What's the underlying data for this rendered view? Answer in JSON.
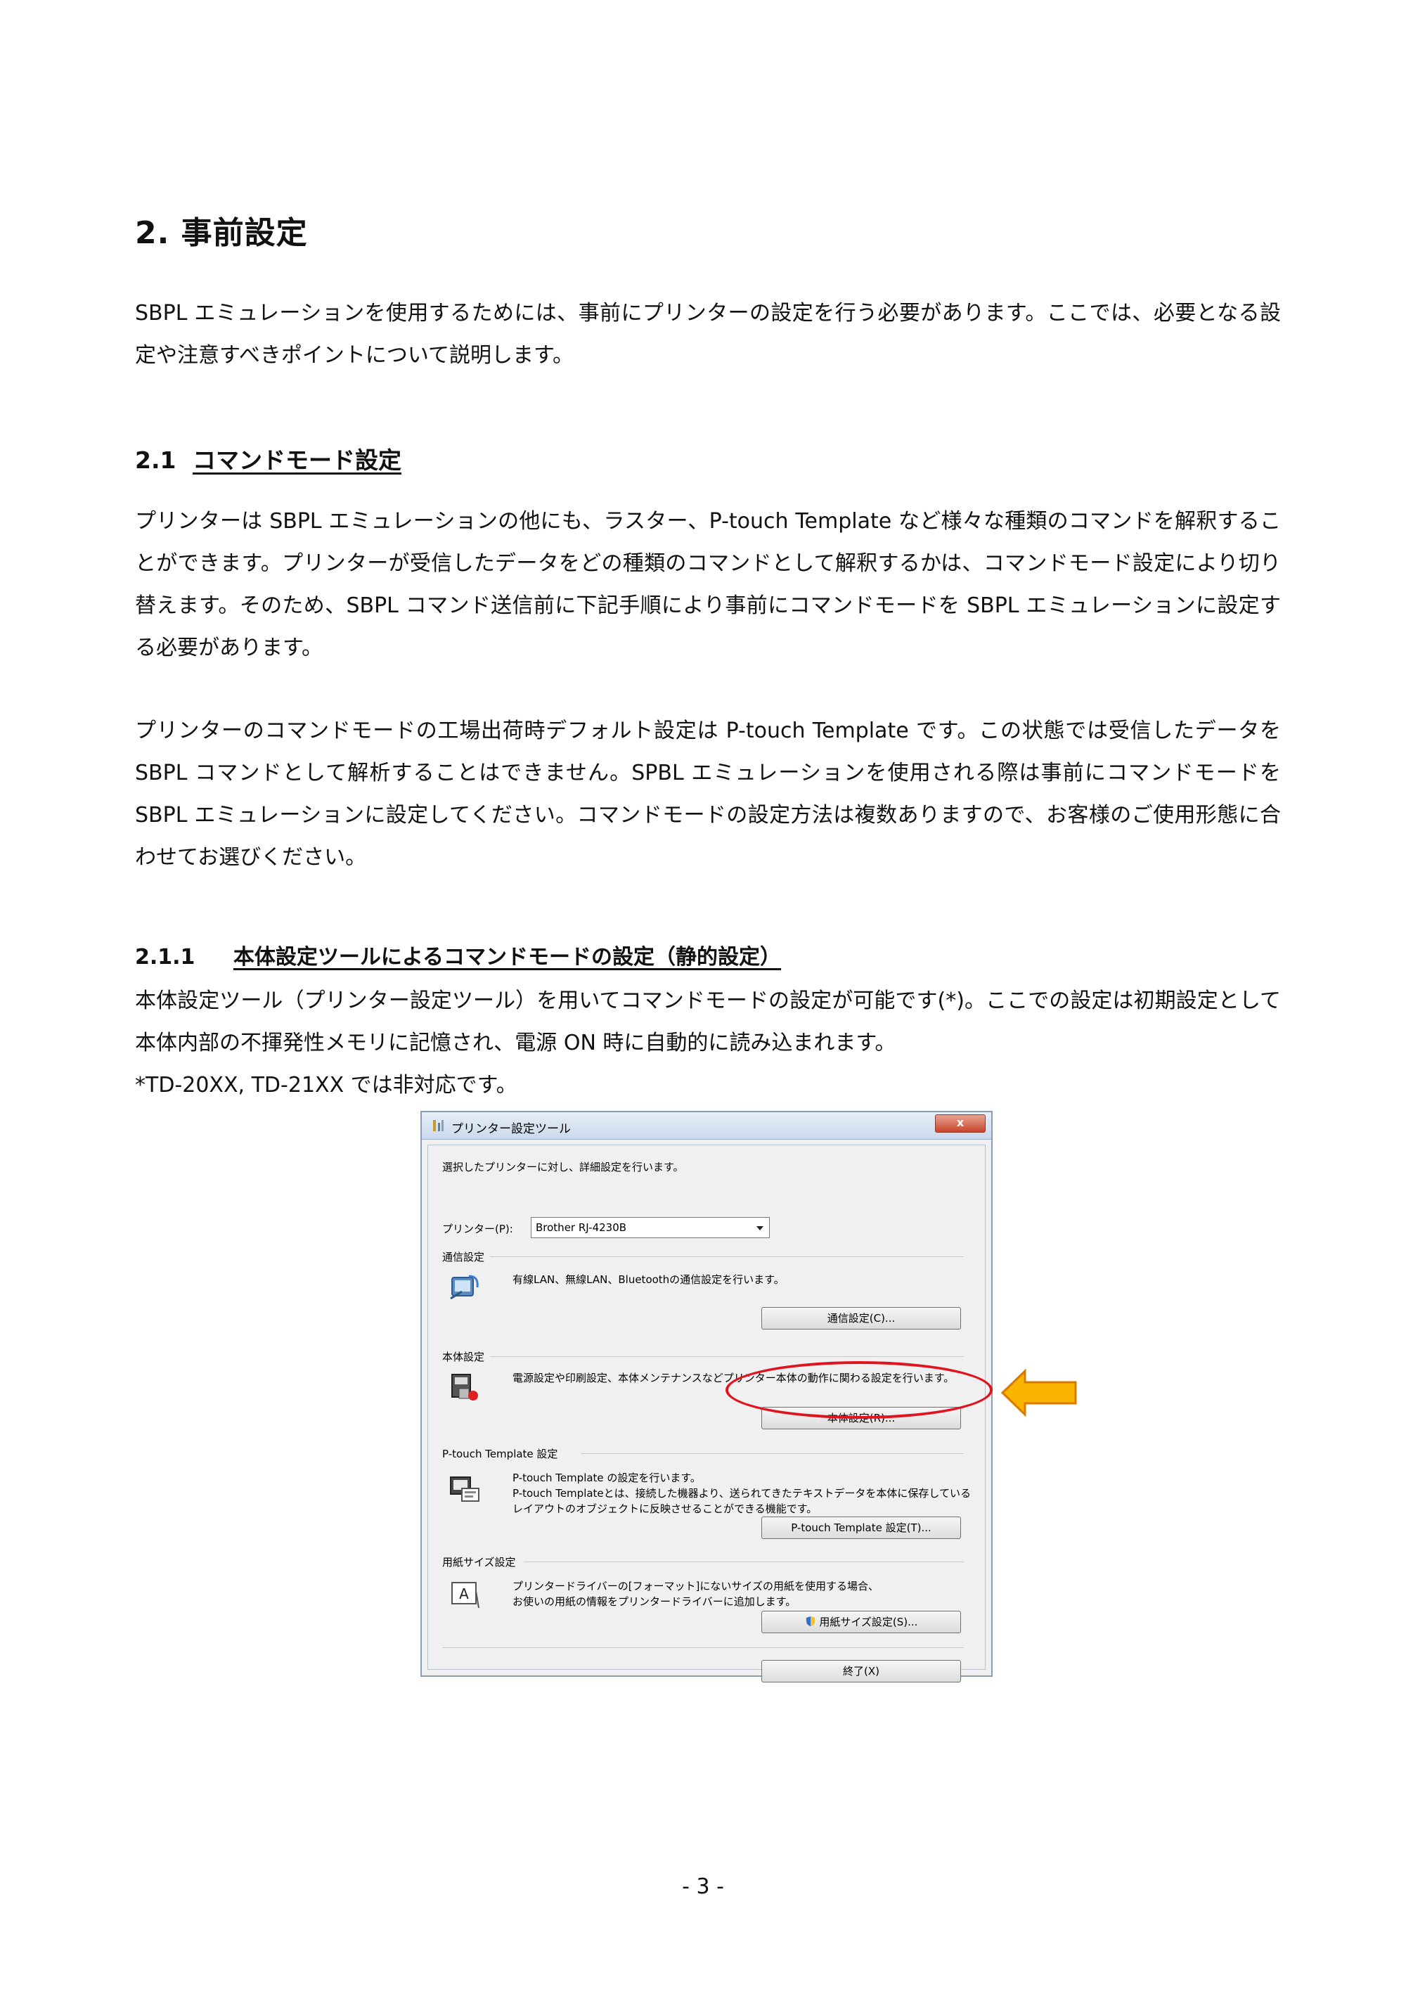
{
  "section": {
    "title": "2.  事前設定",
    "intro": "SBPL エミュレーションを使用するためには、事前にプリンターの設定を行う必要があります。ここでは、必要となる設定や注意すべきポイントについて説明します。"
  },
  "subsection": {
    "number": "2.1",
    "title": "コマンドモード設定",
    "para1": "プリンターは SBPL エミュレーションの他にも、ラスター、P-touch Template など様々な種類のコマンドを解釈することができます。プリンターが受信したデータをどの種類のコマンドとして解釈するかは、コマンドモード設定により切り替えます。そのため、SBPL コマンド送信前に下記手順により事前にコマンドモードを SBPL エミュレーションに設定する必要があります。",
    "para2": "プリンターのコマンドモードの工場出荷時デフォルト設定は P-touch Template です。この状態では受信したデータを SBPL コマンドとして解析することはできません。SPBL エミュレーションを使用される際は事前にコマンドモードを SBPL エミュレーションに設定してください。コマンドモードの設定方法は複数ありますので、お客様のご使用形態に合わせてお選びください。"
  },
  "subsubsection": {
    "number": "2.1.1",
    "title": "本体設定ツールによるコマンドモードの設定（静的設定）",
    "para1": "本体設定ツール（プリンター設定ツール）を用いてコマンドモードの設定が可能です(*)。ここでの設定は初期設定として本体内部の不揮発性メモリに記憶され、電源 ON 時に自動的に読み込まれます。",
    "note": "*TD-20XX, TD-21XX では非対応です。"
  },
  "dialog": {
    "title": "プリンター設定ツール",
    "close": "x",
    "instruction": "選択したプリンターに対し、詳細設定を行います。",
    "printer_label": "プリンター(P):",
    "printer_value": "Brother RJ-4230B",
    "comm": {
      "heading": "通信設定",
      "desc": "有線LAN、無線LAN、Bluetoothの通信設定を行います。",
      "button": "通信設定(C)..."
    },
    "device": {
      "heading": "本体設定",
      "desc": "電源設定や印刷設定、本体メンテナンスなどプリンター本体の動作に関わる設定を行います。",
      "button": "本体設定(R)..."
    },
    "ptouch": {
      "heading": "P-touch Template 設定",
      "desc1": "P-touch Template の設定を行います。",
      "desc2": "P-touch Templateとは、接続した機器より、送られてきたテキストデータを本体に保存している",
      "desc3": "レイアウトのオブジェクトに反映させることができる機能です。",
      "button": "P-touch Template 設定(T)..."
    },
    "paper": {
      "heading": "用紙サイズ設定",
      "desc1": "プリンタードライバーの[フォーマット]にないサイズの用紙を使用する場合、",
      "desc2": "お使いの用紙の情報をプリンタードライバーに追加します。",
      "button": "用紙サイズ設定(S)..."
    },
    "exit_button": "終了(X)"
  },
  "page_number": "- 3 -",
  "colors": {
    "highlight_ring": "#e0141e",
    "arrow_fill": "#f8b400",
    "arrow_stroke": "#d97a00"
  }
}
